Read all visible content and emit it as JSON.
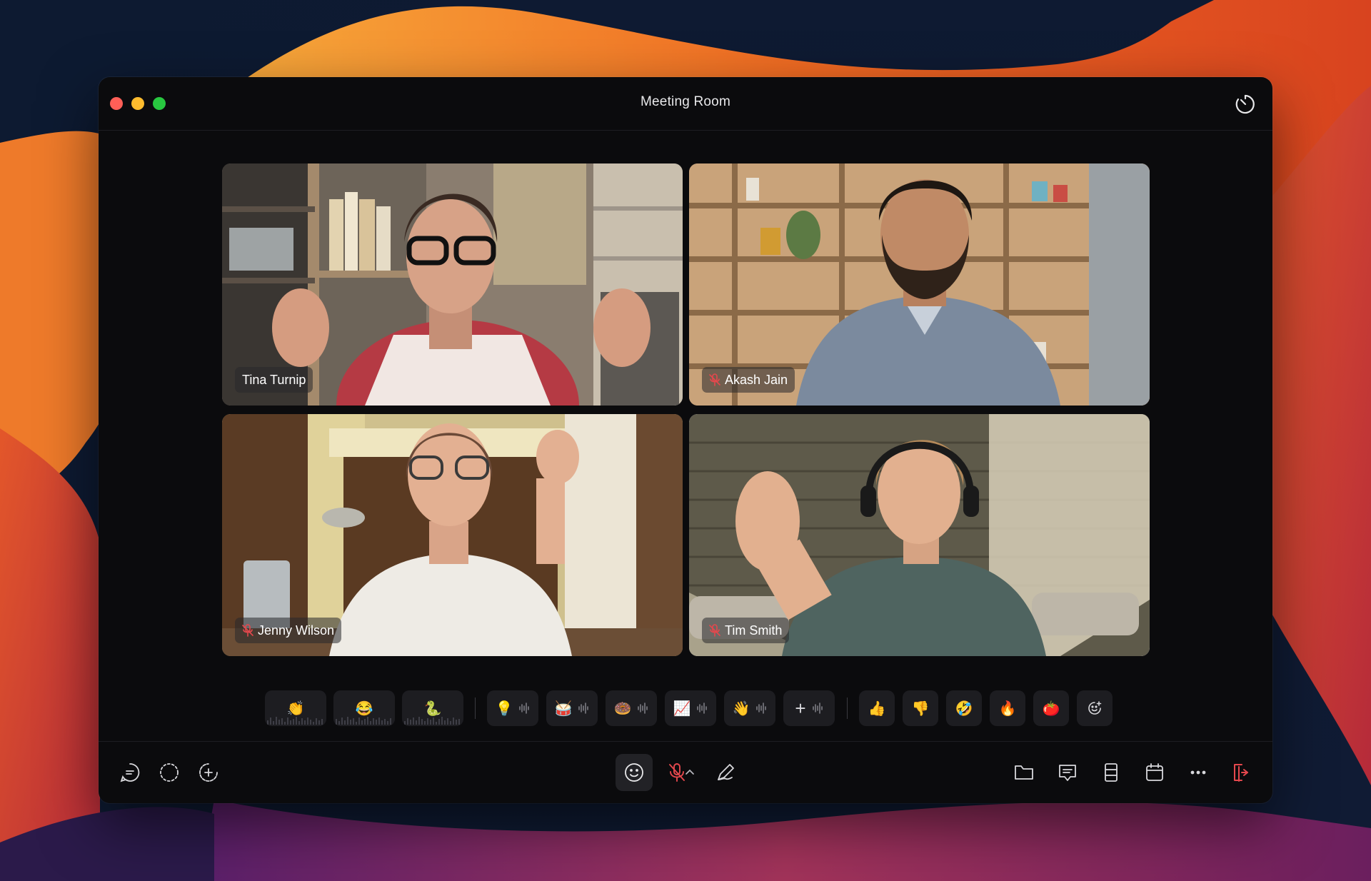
{
  "window": {
    "title": "Meeting Room"
  },
  "participants": [
    {
      "name": "Tina Turnip",
      "muted": false,
      "active": false
    },
    {
      "name": "Akash Jain",
      "muted": true,
      "active": false
    },
    {
      "name": "Jenny Wilson",
      "muted": true,
      "active": false
    },
    {
      "name": "Tim Smith",
      "muted": true,
      "active": true
    }
  ],
  "reactions": {
    "sounds": [
      "👏",
      "😂",
      "🐍"
    ],
    "soundboard": [
      "💡",
      "🥁",
      "🍩",
      "📈",
      "👋",
      "+"
    ],
    "quick": [
      "👍",
      "👎",
      "🤣",
      "🔥",
      "🍅"
    ]
  },
  "colors": {
    "accent_red": "#e5484d",
    "window_bg": "#0b0b0d",
    "tile_border_active": "#ffffff"
  },
  "icons": {
    "left": [
      "chat-bubble-icon",
      "moon-icon",
      "add-circle-icon"
    ],
    "center": [
      "emoji-icon",
      "mic-muted-icon",
      "chevron-up-icon",
      "pen-sparkle-icon"
    ],
    "right": [
      "folder-icon",
      "comment-icon",
      "layout-icon",
      "calendar-icon",
      "more-icon",
      "leave-icon"
    ]
  }
}
